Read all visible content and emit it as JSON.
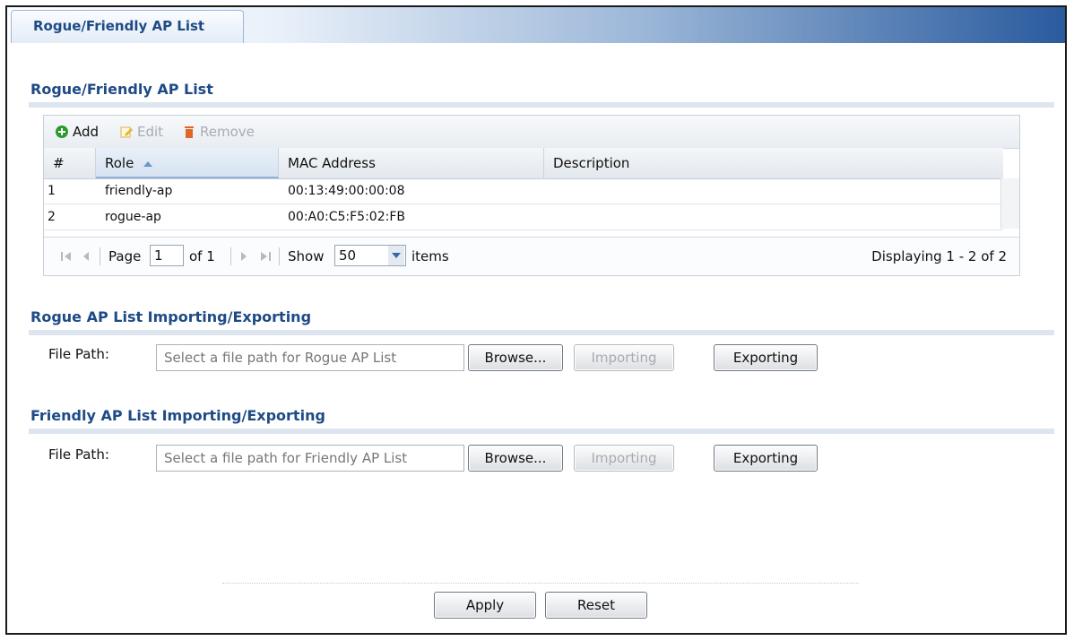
{
  "tab": {
    "label": "Rogue/Friendly AP List"
  },
  "ap_list": {
    "title": "Rogue/Friendly AP List",
    "toolbar": {
      "add": "Add",
      "edit": "Edit",
      "remove": "Remove"
    },
    "columns": {
      "num": "#",
      "role": "Role",
      "mac": "MAC Address",
      "description": "Description"
    },
    "rows": [
      {
        "num": "1",
        "role": "friendly-ap",
        "mac": "00:13:49:00:00:08",
        "description": ""
      },
      {
        "num": "2",
        "role": "rogue-ap",
        "mac": "00:A0:C5:F5:02:FB",
        "description": ""
      }
    ],
    "pager": {
      "page_label": "Page",
      "page_value": "1",
      "of_label": "of 1",
      "show_label": "Show",
      "show_value": "50",
      "items_label": "items",
      "displaying": "Displaying 1 - 2 of 2"
    }
  },
  "rogue_io": {
    "title": "Rogue AP List Importing/Exporting",
    "file_label": "File Path:",
    "placeholder": "Select a file path for Rogue AP List",
    "browse": "Browse...",
    "importing": "Importing",
    "exporting": "Exporting"
  },
  "friendly_io": {
    "title": "Friendly AP List Importing/Exporting",
    "file_label": "File Path:",
    "placeholder": "Select a file path for Friendly AP List",
    "browse": "Browse...",
    "importing": "Importing",
    "exporting": "Exporting"
  },
  "footer": {
    "apply": "Apply",
    "reset": "Reset"
  },
  "colors": {
    "accent": "#1e4a86",
    "add_green": "#2e9a2e",
    "remove_orange": "#e0662a",
    "edit_yellow": "#e6b62e"
  },
  "icons": [
    "add-icon",
    "edit-icon",
    "remove-icon",
    "sort-asc-icon",
    "first-page-icon",
    "prev-page-icon",
    "next-page-icon",
    "last-page-icon",
    "dropdown-icon"
  ]
}
